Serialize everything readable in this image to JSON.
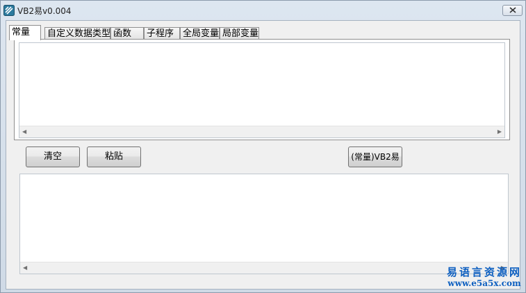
{
  "window": {
    "title": "VB2易v0.004",
    "icon": "app-icon",
    "close_icon": "close-icon"
  },
  "tabs": [
    {
      "label": "常量",
      "active": true
    },
    {
      "label": "自定义数据类型",
      "active": false
    },
    {
      "label": "函数",
      "active": false
    },
    {
      "label": "子程序",
      "active": false
    },
    {
      "label": "全局变量",
      "active": false
    },
    {
      "label": "局部变量",
      "active": false
    }
  ],
  "buttons": {
    "clear": "清空",
    "paste": "粘贴",
    "convert": "(常量)VB2易"
  },
  "scroll_arrows": {
    "left": "◀",
    "right": "▶"
  },
  "watermark": {
    "line1": "易语言资源网",
    "line2": "www.e5a5x.com"
  },
  "colors": {
    "watermark": "#0d5fc0",
    "window_frame": "#dde6f0",
    "client": "#f0f0f0"
  }
}
